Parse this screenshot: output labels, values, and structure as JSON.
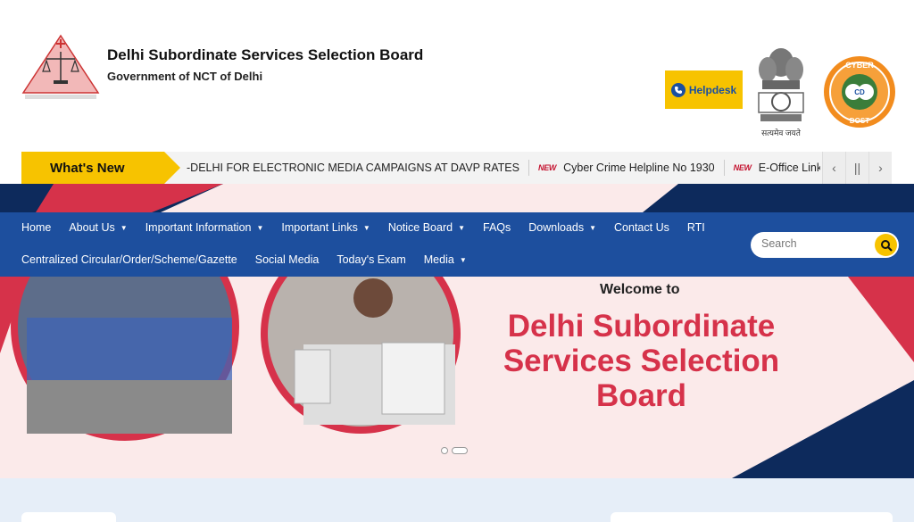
{
  "header": {
    "org_name": "Delhi Subordinate Services Selection Board",
    "org_sub": "Government of NCT of Delhi",
    "helpdesk_label": "Helpdesk",
    "emblem_motto": "सत्यमेव जयते",
    "cyber_top": "CYBER",
    "cyber_bottom": "DOST",
    "cyber_mid": "CD"
  },
  "ticker": {
    "heading": "What's New",
    "badge": "NEW",
    "items": [
      "-DELHI FOR ELECTRONIC MEDIA CAMPAIGNS AT DAVP RATES",
      "Cyber Crime Helpline No 1930",
      "E-Office Link",
      ""
    ],
    "prev": "‹",
    "pause": "||",
    "next": "›"
  },
  "nav": {
    "row1": [
      "Home",
      "About Us",
      "Important Information",
      "Important Links",
      "Notice Board",
      "FAQs",
      "Downloads",
      "Contact Us",
      "RTI"
    ],
    "row2": [
      "Centralized Circular/Order/Scheme/Gazette",
      "Social Media",
      "Today's Exam",
      "Media"
    ],
    "search_placeholder": "Search"
  },
  "banner": {
    "welcome": "Welcome to",
    "title": "Delhi Subordinate Services Selection Board"
  },
  "colors": {
    "nav_blue": "#1d4f9e",
    "accent_yellow": "#f7c300",
    "banner_red": "#d6324a",
    "navy": "#0d2a5c"
  }
}
